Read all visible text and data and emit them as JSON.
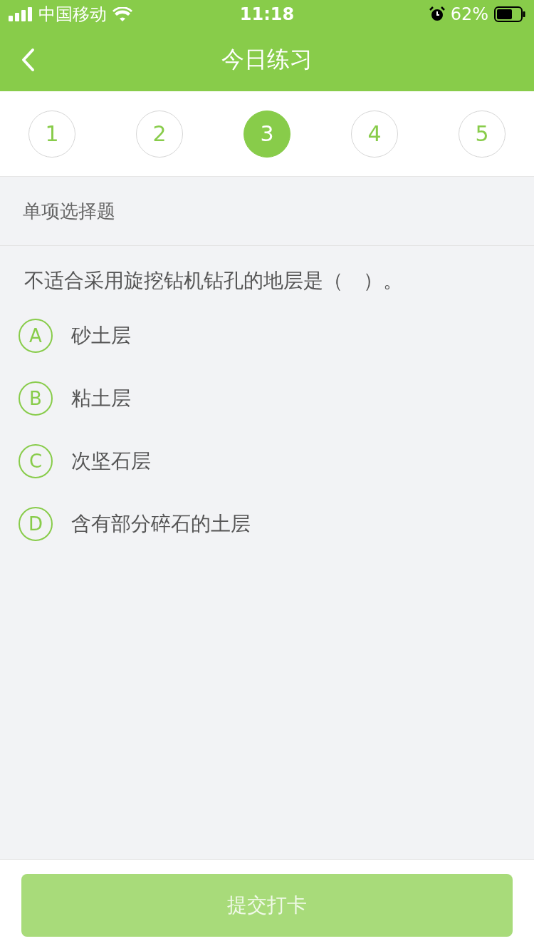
{
  "status_bar": {
    "carrier": "中国移动",
    "time": "11:18",
    "battery": "62%"
  },
  "nav": {
    "title": "今日练习"
  },
  "question_tabs": [
    {
      "label": "1",
      "selected": false
    },
    {
      "label": "2",
      "selected": false
    },
    {
      "label": "3",
      "selected": true
    },
    {
      "label": "4",
      "selected": false
    },
    {
      "label": "5",
      "selected": false
    }
  ],
  "section": "单项选择题",
  "question": "不适合采用旋挖钻机钻孔的地层是（　）。",
  "options": [
    {
      "letter": "A",
      "text": "砂土层",
      "selected": false
    },
    {
      "letter": "B",
      "text": "粘土层",
      "selected": false
    },
    {
      "letter": "C",
      "text": "次坚石层",
      "selected": false
    },
    {
      "letter": "D",
      "text": "含有部分碎石的土层",
      "selected": false
    }
  ],
  "submit": {
    "label": "提交打卡",
    "disabled": true
  }
}
